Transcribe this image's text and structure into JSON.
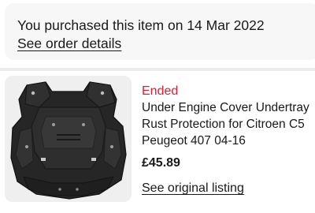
{
  "purchase": {
    "message": "You purchased this item on 14 Mar 2022",
    "order_link": "See order details"
  },
  "item": {
    "status": "Ended",
    "status_color": "#dd1e31",
    "title_lines": [
      "Under Engine Cover Undertray",
      "Rust Protection for Citroen C5",
      "Peugeot 407 04-16"
    ],
    "price": "£45.89",
    "listing_link": "See original listing",
    "image_icon": "undertray-product-photo"
  }
}
